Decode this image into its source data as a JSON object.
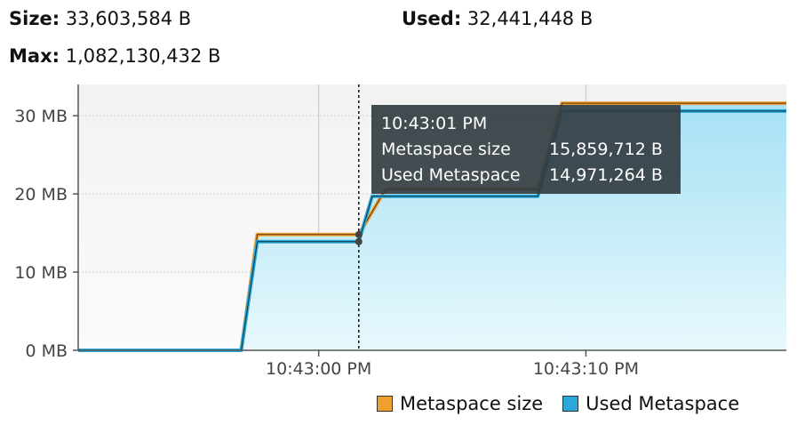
{
  "stats": {
    "size_label": "Size:",
    "size_value": "33,603,584 B",
    "used_label": "Used:",
    "used_value": "32,441,448 B",
    "max_label": "Max:",
    "max_value": "1,082,130,432 B"
  },
  "colors": {
    "metaspace_size": "#f0a030",
    "used_metaspace": "#2aa8d8",
    "area_top": "#a8e2f4",
    "area_bottom": "#e8f8fd",
    "tooltip_bg": "#333d42"
  },
  "tooltip": {
    "time": "10:43:01 PM",
    "rows": [
      {
        "label": "Metaspace size",
        "value": "15,859,712 B"
      },
      {
        "label": "Used Metaspace",
        "value": "14,971,264 B"
      }
    ]
  },
  "legend": [
    {
      "label": "Metaspace size",
      "color": "#f0a030"
    },
    {
      "label": "Used Metaspace",
      "color": "#2aa8d8"
    }
  ],
  "chart_data": {
    "type": "area",
    "x_unit": "seconds after 10:42:51 PM",
    "y_unit": "MB",
    "ylim": [
      0,
      34
    ],
    "y_ticks": [
      {
        "value": 0,
        "label": "0 MB"
      },
      {
        "value": 10,
        "label": "10 MB"
      },
      {
        "value": 20,
        "label": "20 MB"
      },
      {
        "value": 30,
        "label": "30 MB"
      }
    ],
    "x_ticks": [
      {
        "value": 9,
        "label": "10:43:00 PM"
      },
      {
        "value": 19,
        "label": "10:43:10 PM"
      }
    ],
    "xlim": [
      0,
      26.5
    ],
    "cursor_x": 10.5,
    "grid": true,
    "series": [
      {
        "name": "Metaspace size",
        "x": [
          0,
          6.1,
          6.7,
          10.5,
          11.5,
          17.2,
          18.1,
          26.5
        ],
        "values": [
          0,
          0,
          14.8,
          14.8,
          20.6,
          20.6,
          31.6,
          31.6
        ]
      },
      {
        "name": "Used Metaspace",
        "x": [
          0,
          6.1,
          6.7,
          10.5,
          11.0,
          17.2,
          18.1,
          26.5
        ],
        "values": [
          0,
          0,
          13.9,
          13.9,
          19.7,
          19.7,
          30.6,
          30.6
        ]
      }
    ]
  }
}
